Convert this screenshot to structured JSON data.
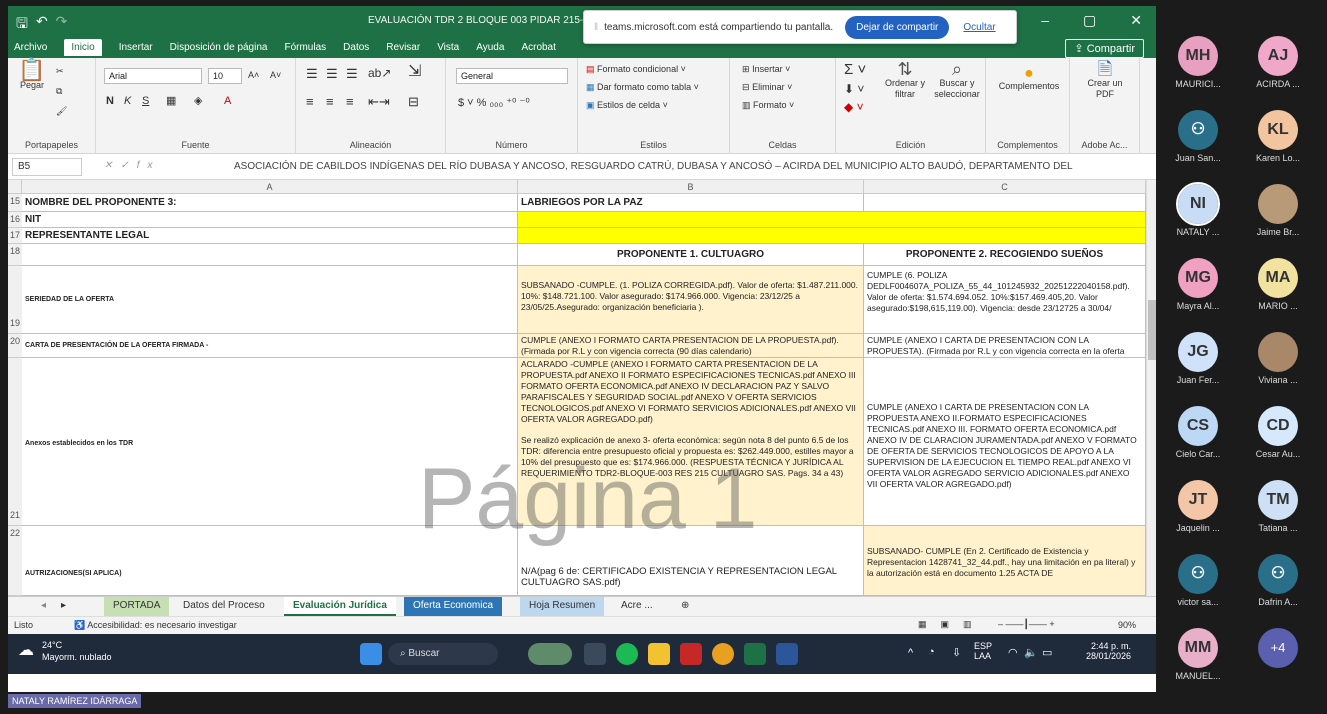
{
  "excel": {
    "title_bar": {
      "document_title": "EVALUACIÓN TDR 2 BLOQUE 003 PIDAR 215-202"
    },
    "teams_share_bar": {
      "message": "teams.microsoft.com está compartiendo tu pantalla.",
      "stop_label": "Dejar de compartir",
      "hide_label": "Ocultar"
    },
    "menu": [
      "Archivo",
      "Inicio",
      "Insertar",
      "Disposición de página",
      "Fórmulas",
      "Datos",
      "Revisar",
      "Vista",
      "Ayuda",
      "Acrobat"
    ],
    "share_button": "Compartir",
    "ribbon": {
      "paste": "Pegar",
      "font_name": "Arial",
      "font_size": "10",
      "number_format": "General",
      "cond_format": "Formato condicional",
      "format_table": "Dar formato como tabla",
      "cell_styles": "Estilos de celda",
      "insert": "Insertar",
      "delete": "Eliminar",
      "format": "Formato",
      "sort_filter": "Ordenar y filtrar",
      "find_select": "Buscar y seleccionar",
      "complements": "Complementos",
      "create_pdf": "Crear un PDF",
      "groups": [
        "Portapapeles",
        "Fuente",
        "Alineación",
        "Número",
        "Estilos",
        "Celdas",
        "Edición",
        "Complementos",
        "Adobe Ac..."
      ]
    },
    "formula_bar": {
      "name_box": "B5",
      "content": "ASOCIACIÓN DE CABILDOS INDÍGENAS DEL RÍO DUBASA Y ANCOSO, RESGUARDO CATRÚ, DUBASA Y ANCOSÓ – ACIRDA DEL MUNICIPIO ALTO BAUDÓ, DEPARTAMENTO DEL"
    },
    "columns": [
      "A",
      "B",
      "C"
    ],
    "rows": [
      {
        "num": "15",
        "a": "NOMBRE DEL PROPONENTE 3:",
        "b": "LABRIEGOS POR LA PAZ",
        "c": ""
      },
      {
        "num": "16",
        "a": "NIT",
        "b": "",
        "c": ""
      },
      {
        "num": "17",
        "a": "REPRESENTANTE LEGAL",
        "b": "",
        "c": ""
      },
      {
        "num": "18",
        "a": "",
        "b": "PROPONENTE 1. CULTUAGRO",
        "c": "PROPONENTE 2. RECOGIENDO SUEÑOS"
      },
      {
        "num": "19",
        "a": "SERIEDAD DE LA OFERTA",
        "b": "SUBSANADO -CUMPLE. (1. POLIZA CORREGIDA.pdf). Valor de oferta: $1.487.211.000. 10%: $148.721.100. Valor asegurado: $174.966.000. Vigencia: 23/12/25 a 23/05/25.Asegurado: organización beneficiaria ).",
        "c": "CUMPLE (6. POLIZA DEDLF004607A_POLIZA_55_44_101245932_20251222040158.pdf). Valor de oferta: $1.574.694.052. 10%:$157.469.405,20. Valor asegurado:$198,615,119.00). Vigencia: desde 23/12725 a 30/04/"
      },
      {
        "num": "20",
        "a": "CARTA DE PRESENTACIÓN DE LA OFERTA FIRMADA -",
        "b": "CUMPLE (ANEXO I FORMATO CARTA PRESENTACION DE LA PROPUESTA.pdf). (Firmada por R.L y con vigencia correcta (90 días calendario)",
        "c": "CUMPLE (ANEXO I CARTA DE PRESENTACION CON LA PROPUESTA). (Firmada por R.L y con vigencia correcta en la oferta económ"
      },
      {
        "num": "21",
        "a": "Anexos establecidos en los TDR",
        "b": "ACLARADO -CUMPLE (ANEXO I FORMATO CARTA PRESENTACION DE LA PROPUESTA.pdf ANEXO II FORMATO ESPECIFICACIONES TECNICAS.pdf ANEXO III FORMATO OFERTA ECONOMICA.pdf ANEXO IV DECLARACION PAZ Y SALVO PARAFISCALES Y SEGURIDAD SOCIAL.pdf ANEXO V OFERTA SERVICIOS TECNOLOGICOS.pdf ANEXO VI FORMATO SERVICIOS ADICIONALES.pdf ANEXO VII OFERTA VALOR AGREGADO.pdf)",
        "b2": "Se realizó explicación de anexo 3- oferta económica: según nota 8 del punto 6.5 de los TDR: diferencia entre presupuesto oficial y propuesta es: $262.449.000, estilles mayor a 10% del presupuesto que es: $174.966.000. (RESPUESTA TÉCNICA Y JURÍDICA AL REQUERIMIENTO TDR2-BLOQUE-003 RES 215 CULTUAGRO SAS. Pags. 34 a 43)",
        "c": "CUMPLE (ANEXO I CARTA DE PRESENTACION CON LA PROPUESTA ANEXO II.FORMATO ESPECIFICACIONES TECNICAS.pdf ANEXO III. FORMATO OFERTA ECONOMICA.pdf ANEXO IV DE CLARACION JURAMENTADA.pdf ANEXO V FORMATO DE OFERTA DE SERVICIOS TECNOLOGICOS DE APOYO A LA SUPERVISION DE LA EJECUCION EL TIEMPO REAL.pdf ANEXO VI OFERTA VALOR AGREGADO SERVICIO ADICIONALES.pdf ANEXO VII OFERTA VALOR AGREGADO.pdf)"
      },
      {
        "num": "22",
        "a": "AUTRIZACIONES(SI APLICA)",
        "b": "N/A(pag 6 de: CERTIFICADO EXISTENCIA Y REPRESENTACION LEGAL CULTUAGRO SAS.pdf)",
        "c": "SUBSANADO- CUMPLE (En 2. Certificado de Existencia y Representacion 1428741_32_44.pdf., hay una limitación en pa literal) y la autorización está en documento 1.25 ACTA DE"
      }
    ],
    "watermark": "Página 1",
    "sheet_tabs": [
      "PORTADA",
      "Datos del Proceso",
      "Evaluación Jurídica",
      "Oferta Economica",
      "Hoja Resumen",
      "Acre ..."
    ],
    "status": {
      "mode": "Listo",
      "accessibility": "Accesibilidad: es necesario investigar",
      "zoom": "90%"
    },
    "taskbar": {
      "weather_temp": "24°C",
      "weather_desc": "Mayorm. nublado",
      "search": "Buscar",
      "lang1": "ESP",
      "lang2": "LAA",
      "time": "2:44 p. m.",
      "date": "28/01/2026"
    }
  },
  "presenter_name": "NATALY RAMÍREZ IDÁRRAGA",
  "participants": [
    {
      "initials": "MH",
      "name": "MAURICI...",
      "color": "#e8a0c0"
    },
    {
      "initials": "AJ",
      "name": "ACIRDA ...",
      "color": "#f0a8c8"
    },
    {
      "initials": "",
      "name": "Juan San...",
      "color": "#2a6f8a",
      "icon": "person"
    },
    {
      "initials": "KL",
      "name": "Karen Lo...",
      "color": "#f2c5a0"
    },
    {
      "initials": "NI",
      "name": "NATALY ...",
      "color": "#c9dcf5"
    },
    {
      "initials": "",
      "name": "Jaime Br...",
      "color": "#b89a78",
      "icon": "photo"
    },
    {
      "initials": "MG",
      "name": "Mayra Al...",
      "color": "#f0a0c0"
    },
    {
      "initials": "MA",
      "name": "MARIO ...",
      "color": "#f2e2a0"
    },
    {
      "initials": "JG",
      "name": "Juan Fer...",
      "color": "#cfe2fa"
    },
    {
      "initials": "",
      "name": "Viviana ...",
      "color": "#a88868",
      "icon": "photo"
    },
    {
      "initials": "CS",
      "name": "Cielo Car...",
      "color": "#bcd8f5"
    },
    {
      "initials": "CD",
      "name": "Cesar Au...",
      "color": "#d6e8fb"
    },
    {
      "initials": "JT",
      "name": "Jaquelin ...",
      "color": "#f4c6a8"
    },
    {
      "initials": "TM",
      "name": "Tatiana ...",
      "color": "#cde0f6"
    },
    {
      "initials": "",
      "name": "victor sa...",
      "color": "#2a6f8a",
      "icon": "person"
    },
    {
      "initials": "",
      "name": "Dafrin A...",
      "color": "#2a6f8a",
      "icon": "person"
    },
    {
      "initials": "MM",
      "name": "MANUEL...",
      "color": "#e8b0c8"
    },
    {
      "initials": "+4",
      "name": "",
      "color": "#5a5fb0"
    }
  ]
}
